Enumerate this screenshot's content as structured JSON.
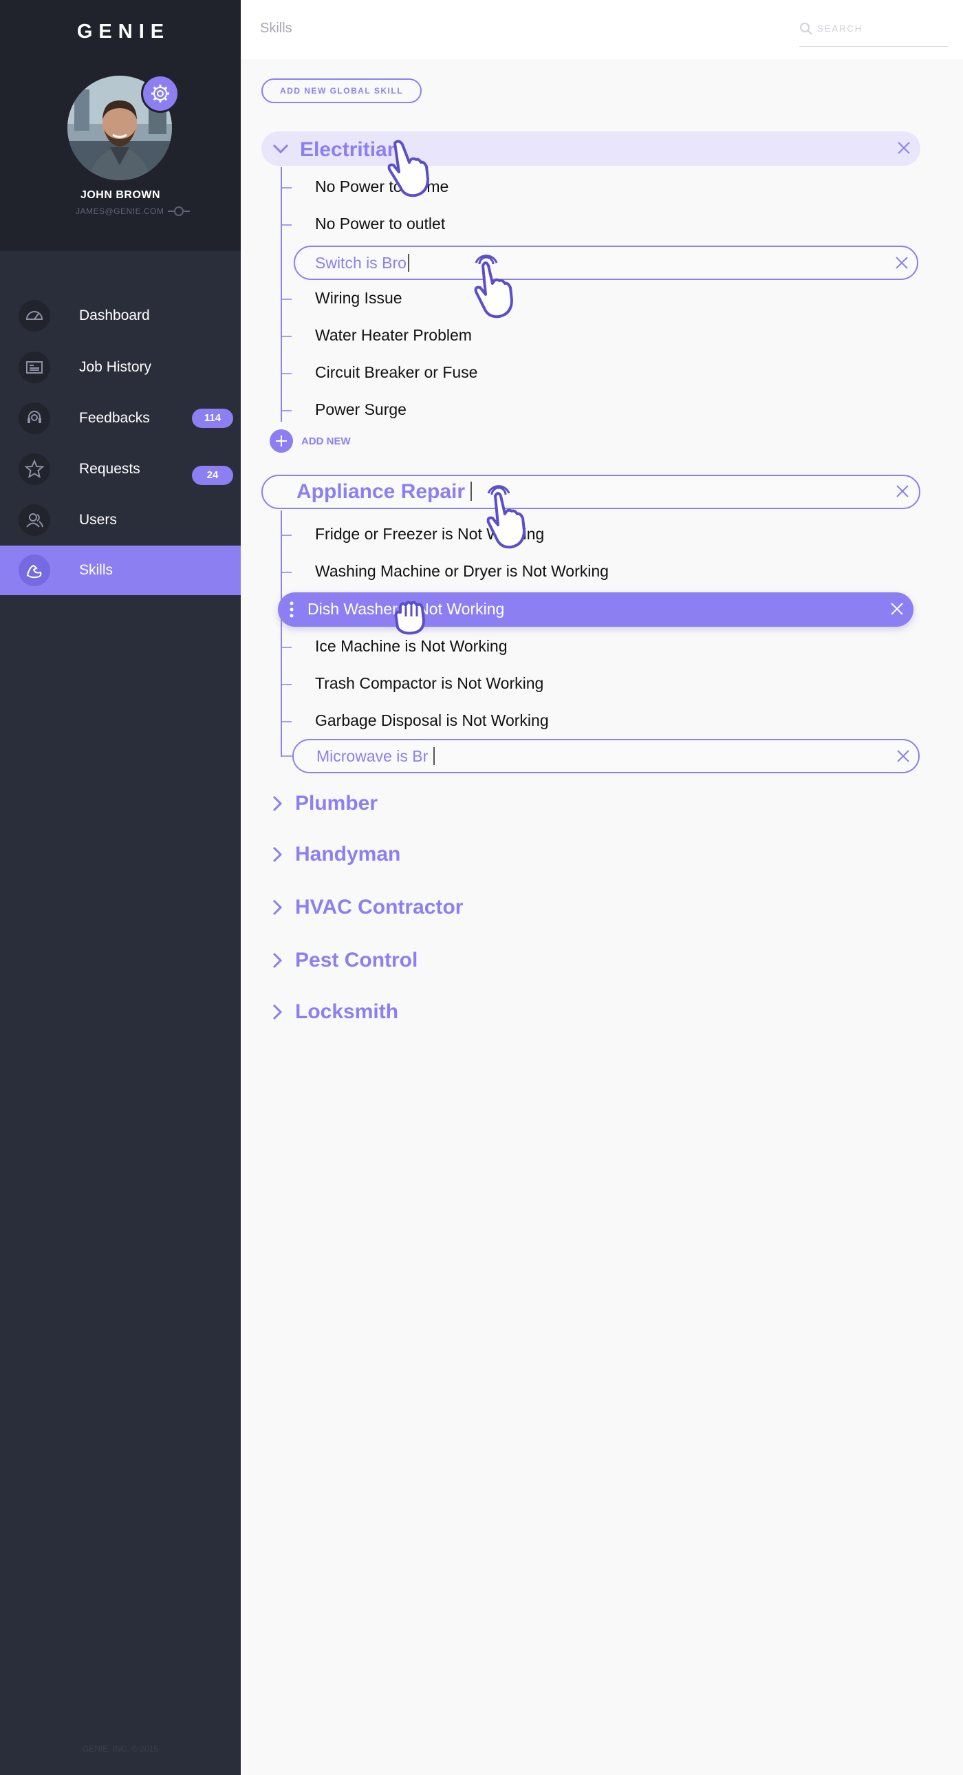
{
  "app": {
    "brand": "GENIE",
    "copyright": "GENIE, INC. © 2015"
  },
  "user": {
    "name": "JOHN BROWN",
    "email": "JAMES@GENIE.COM"
  },
  "nav": [
    {
      "label": "Dashboard",
      "icon": "gauge-icon"
    },
    {
      "label": "Job History",
      "icon": "newspaper-icon"
    },
    {
      "label": "Feedbacks",
      "icon": "headset-icon",
      "badge": "114"
    },
    {
      "label": "Requests",
      "icon": "star-icon",
      "badge": "24"
    },
    {
      "label": "Users",
      "icon": "users-icon"
    },
    {
      "label": "Skills",
      "icon": "arm-icon",
      "active": true
    }
  ],
  "header": {
    "title": "Skills",
    "search_placeholder": "SEARCH"
  },
  "actions": {
    "add_global": "ADD NEW GLOBAL SKILL",
    "add_new": "ADD NEW"
  },
  "colors": {
    "accent": "#8b7ff2",
    "sidebar": "#2a2e3a",
    "sidebar_top": "#20232c"
  },
  "categories": {
    "electrician": {
      "title": "Electritian",
      "items": [
        "No Power to Home",
        "No Power to outlet",
        "Switch is Bro",
        "Wiring Issue",
        "Water Heater Problem",
        "Circuit Breaker or Fuse",
        "Power Surge"
      ]
    },
    "appliance": {
      "title": "Appliance Repair",
      "items": [
        "Fridge or Freezer is Not Working",
        "Washing Machine or Dryer is Not Working",
        "Dish Washer is Not Working",
        "Ice Machine is Not Working",
        "Trash Compactor is Not Working",
        "Garbage Disposal is Not Working",
        "Microwave is Br"
      ]
    },
    "collapsed": [
      "Plumber",
      "Handyman",
      "HVAC Contractor",
      "Pest Control",
      "Locksmith"
    ]
  }
}
